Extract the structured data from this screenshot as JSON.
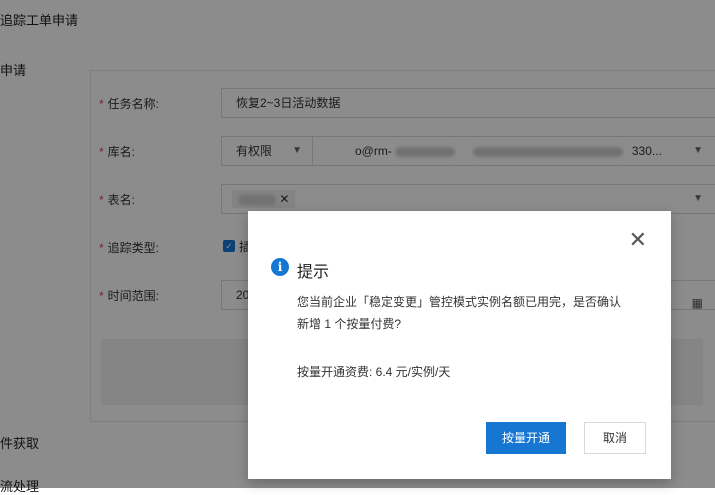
{
  "page": {
    "title": "追踪工单申请",
    "section_title": "申请",
    "section_2": "件获取",
    "section_3": "流处理"
  },
  "form": {
    "task_name": {
      "label": "任务名称:",
      "value": "恢复2~3日活动数据"
    },
    "db": {
      "label": "库名:",
      "permission": "有权限",
      "value_prefix": "o@rm-",
      "value_suffix": "330..."
    },
    "table": {
      "label": "表名:"
    },
    "track_type": {
      "label": "追踪类型:",
      "option": "插"
    },
    "time_range": {
      "label": "时间范围:",
      "value": "20"
    }
  },
  "modal": {
    "title": "提示",
    "body": "您当前企业「稳定变更」管控模式实例名额已用完，是否确认新增 1 个按量付费?",
    "fee": "按量开通资费: 6.4 元/实例/天",
    "confirm": "按量开通",
    "cancel": "取消"
  },
  "colors": {
    "primary": "#1677d2",
    "overlay": "rgba(0,0,0,0.45)"
  },
  "icons": [
    "chevron-down-icon",
    "close-icon",
    "info-icon",
    "calendar-icon",
    "check-icon"
  ]
}
